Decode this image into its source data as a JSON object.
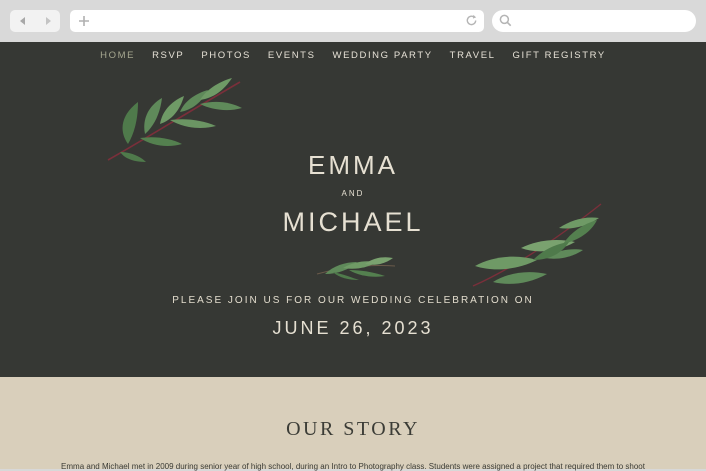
{
  "browser": {
    "back_icon": "back-arrow-icon",
    "forward_icon": "forward-arrow-icon",
    "new_tab_icon": "plus-icon",
    "reload_icon": "reload-icon",
    "search_icon": "search-icon"
  },
  "nav": {
    "items": [
      {
        "label": "HOME",
        "active": true
      },
      {
        "label": "RSVP"
      },
      {
        "label": "PHOTOS"
      },
      {
        "label": "EVENTS"
      },
      {
        "label": "WEDDING PARTY"
      },
      {
        "label": "TRAVEL"
      },
      {
        "label": "GIFT REGISTRY"
      }
    ]
  },
  "hero": {
    "name_one": "EMMA",
    "conjunction": "AND",
    "name_two": "MICHAEL",
    "invite": "PLEASE JOIN US FOR OUR WEDDING CELEBRATION ON",
    "date": "JUNE 26, 2023"
  },
  "story": {
    "title": "OUR STORY",
    "body": "Emma and Michael met in 2009 during senior year of high school, during an Intro to Photography class. Students were assigned a project that required them to shoot"
  },
  "colors": {
    "hero_bg": "#363834",
    "story_bg": "#d9cfbb",
    "nav_active": "#a6a790",
    "text_light": "#e6e0d2",
    "leaf_green": "#5f8a5a",
    "stem": "#7a2f3a"
  }
}
